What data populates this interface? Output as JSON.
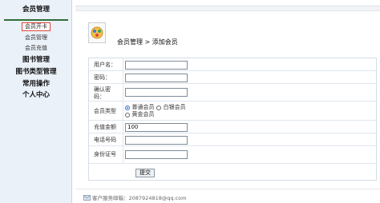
{
  "sidebar": {
    "title": "会员管理",
    "sub_items": [
      "会员开卡",
      "会员管理",
      "会员充值"
    ],
    "groups": [
      "图书管理",
      "图书类型管理",
      "常用操作",
      "个人中心"
    ]
  },
  "header": {
    "breadcrumb": "会员管理 > 添加会员"
  },
  "form": {
    "username_label": "用户名：",
    "password_label": "密码：",
    "confirm_label": "确认密码：",
    "type_label": "会员类型",
    "type_options": [
      "普通会员",
      "白银会员",
      "黄金会员"
    ],
    "type_selected": "普通会员",
    "recharge_label": "充值金额",
    "recharge_value": "100",
    "phone_label": "电话号码",
    "id_label": "身份证号",
    "submit_label": "提交"
  },
  "footer": {
    "text": "客户服务邮箱：2087924818@qq.com"
  },
  "colors": {
    "sidebar_bg": "#eaf1f8",
    "active_border": "#e0453a",
    "separator": "#2f6d3a"
  }
}
